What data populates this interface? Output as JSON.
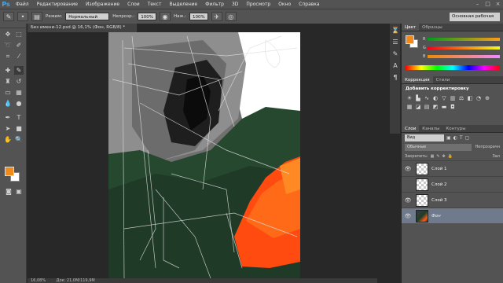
{
  "menubar": {
    "logo": "Ps",
    "items": [
      "Файл",
      "Редактирование",
      "Изображение",
      "Слои",
      "Текст",
      "Выделение",
      "Фильтр",
      "3D",
      "Просмотр",
      "Окно",
      "Справка"
    ],
    "window_controls": [
      "–",
      "□",
      "×"
    ]
  },
  "options_bar": {
    "mode_label": "Режим:",
    "mode_value": "Нормальный",
    "opacity_label": "Непрозр.:",
    "opacity_value": "100%",
    "pressure_label": "Наж.:",
    "pressure_value": "100%",
    "workspace": "Основная рабочая среда"
  },
  "document": {
    "tab_title": "Без имени-12.psd @ 16,1% (Фон, RGB/8) *",
    "status_zoom": "16,08%",
    "status_doc": "Док: 21,0M/119,9M"
  },
  "colors": {
    "foreground": "#f08a1a",
    "background": "#ffffff",
    "accent": "#3fa9f5"
  },
  "color_panel": {
    "tab_color": "Цвет",
    "tab_swatches": "Образцы",
    "channels": [
      "R",
      "G",
      "B"
    ]
  },
  "adjustments_panel": {
    "tab_adjustments": "Коррекция",
    "tab_styles": "Стили",
    "title": "Добавить корректировку"
  },
  "layers_panel": {
    "tabs": [
      "Слои",
      "Каналы",
      "Контуры"
    ],
    "filter_value": "Вид",
    "blend_mode": "Обычные",
    "opacity_label": "Непрозрачн",
    "lock_label": "Закрепить:",
    "fill_label": "Зал",
    "layers": [
      {
        "name": "Слой 1",
        "visible": true,
        "selected": false
      },
      {
        "name": "Слой 2",
        "visible": false,
        "selected": false
      },
      {
        "name": "Слой 3",
        "visible": true,
        "selected": false
      },
      {
        "name": "Фон",
        "visible": true,
        "selected": true
      }
    ]
  },
  "icons": {
    "tools": [
      "move-icon",
      "marquee-icon",
      "lasso-icon",
      "quick-select-icon",
      "crop-icon",
      "eyedropper-icon",
      "healing-icon",
      "brush-icon",
      "clone-stamp-icon",
      "history-brush-icon",
      "eraser-icon",
      "gradient-icon",
      "blur-icon",
      "dodge-icon",
      "pen-icon",
      "type-icon",
      "path-select-icon",
      "shape-icon",
      "hand-icon",
      "zoom-icon"
    ]
  }
}
